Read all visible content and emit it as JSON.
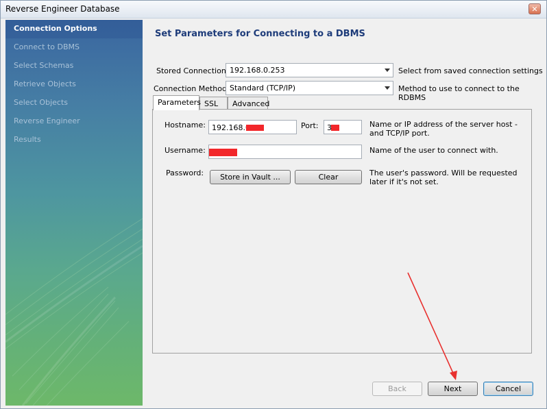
{
  "window": {
    "title": "Reverse Engineer Database"
  },
  "sidebar": {
    "items": [
      {
        "label": "Connection Options",
        "active": true
      },
      {
        "label": "Connect to DBMS",
        "active": false
      },
      {
        "label": "Select Schemas",
        "active": false
      },
      {
        "label": "Retrieve Objects",
        "active": false
      },
      {
        "label": "Select Objects",
        "active": false
      },
      {
        "label": "Reverse Engineer",
        "active": false
      },
      {
        "label": "Results",
        "active": false
      }
    ]
  },
  "main": {
    "heading": "Set Parameters for Connecting to a DBMS",
    "stored_connection": {
      "label": "Stored Connection:",
      "value": "192.168.0.253",
      "help": "Select from saved connection settings"
    },
    "connection_method": {
      "label": "Connection Method:",
      "value": "Standard (TCP/IP)",
      "help": "Method to use to connect to the RDBMS"
    },
    "tabs": [
      {
        "label": "Parameters",
        "active": true
      },
      {
        "label": "SSL",
        "active": false
      },
      {
        "label": "Advanced",
        "active": false
      }
    ],
    "parameters": {
      "hostname": {
        "label": "Hostname:",
        "value": "192.168.0"
      },
      "port": {
        "label": "Port:",
        "value": "3"
      },
      "host_help": "Name or IP address of the server host - and TCP/IP port.",
      "username": {
        "label": "Username:",
        "value": ""
      },
      "username_help": "Name of the user to connect with.",
      "password": {
        "label": "Password:"
      },
      "store_in_vault_label": "Store in Vault ...",
      "clear_label": "Clear",
      "password_help": "The user's password. Will be requested later if it's not set."
    }
  },
  "footer": {
    "back_label": "Back",
    "next_label": "Next",
    "cancel_label": "Cancel"
  },
  "colors": {
    "accent": "#1e3c7a",
    "annotation_arrow": "#e8312f",
    "redaction": "#f2272b"
  }
}
